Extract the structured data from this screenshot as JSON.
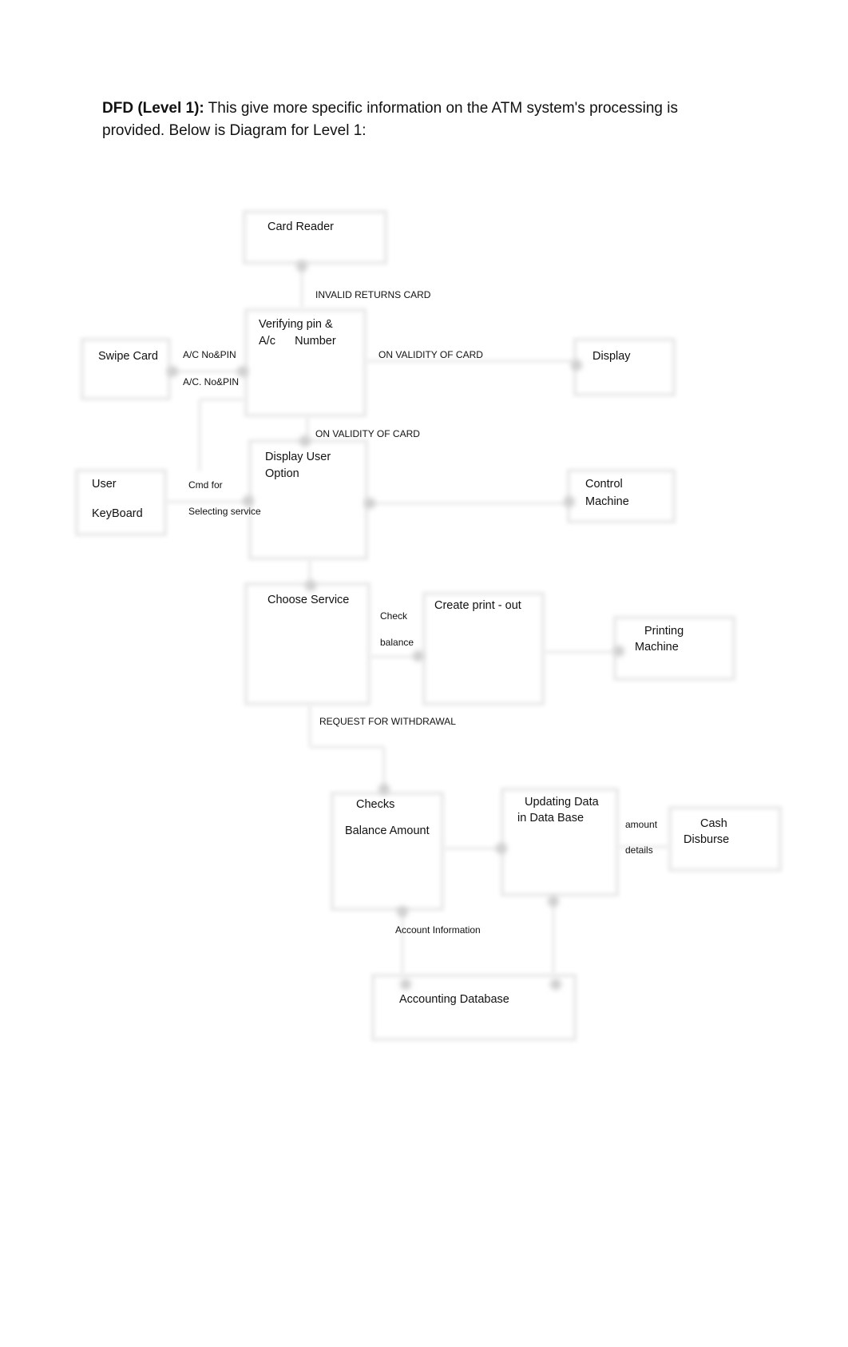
{
  "heading": {
    "bold": "DFD (Level 1):",
    "text": " This give more specific information on the ATM system's processing is provided. Below is Diagram for Level 1:"
  },
  "diagram": {
    "nodes": [
      {
        "id": "card-reader",
        "lines": [
          "Card Reader"
        ]
      },
      {
        "id": "verifying-pin",
        "lines": [
          "Verifying pin &",
          "A/c      Number"
        ]
      },
      {
        "id": "swipe-card",
        "lines": [
          "Swipe Card"
        ]
      },
      {
        "id": "display",
        "lines": [
          "Display"
        ]
      },
      {
        "id": "display-user-option",
        "lines": [
          "Display User",
          "Option"
        ]
      },
      {
        "id": "user-keyboard",
        "lines": [
          "User",
          "KeyBoard"
        ]
      },
      {
        "id": "control-machine",
        "lines": [
          "Control",
          "Machine"
        ]
      },
      {
        "id": "choose-service",
        "lines": [
          "Choose Service"
        ]
      },
      {
        "id": "create-printout",
        "lines": [
          "Create print - out"
        ]
      },
      {
        "id": "printing-machine",
        "lines": [
          "Printing",
          "Machine"
        ]
      },
      {
        "id": "checks-balance",
        "lines": [
          "Checks",
          "Balance Amount"
        ]
      },
      {
        "id": "updating-data",
        "lines": [
          "Updating Data",
          "in Data Base"
        ]
      },
      {
        "id": "cash-disburse",
        "lines": [
          "Cash",
          "Disburse"
        ]
      },
      {
        "id": "accounting-database",
        "lines": [
          "Accounting Database"
        ]
      }
    ],
    "flows": [
      {
        "id": "invalid-returns-card",
        "lines": [
          "INVALID RETURNS CARD"
        ]
      },
      {
        "id": "ac-no-pin",
        "lines": [
          "A/C No&PIN",
          "A/C. No&PIN"
        ]
      },
      {
        "id": "validity-display",
        "lines": [
          "ON VALIDITY OF CARD"
        ]
      },
      {
        "id": "validity-option",
        "lines": [
          "ON VALIDITY OF CARD"
        ]
      },
      {
        "id": "cmd-selecting",
        "lines": [
          "Cmd for",
          "Selecting service"
        ]
      },
      {
        "id": "check-balance",
        "lines": [
          "Check",
          "balance"
        ]
      },
      {
        "id": "request-withdrawal",
        "lines": [
          "REQUEST FOR WITHDRAWAL"
        ]
      },
      {
        "id": "amount-details",
        "lines": [
          "amount",
          "details"
        ]
      },
      {
        "id": "account-information",
        "lines": [
          "Account Information"
        ]
      }
    ]
  }
}
